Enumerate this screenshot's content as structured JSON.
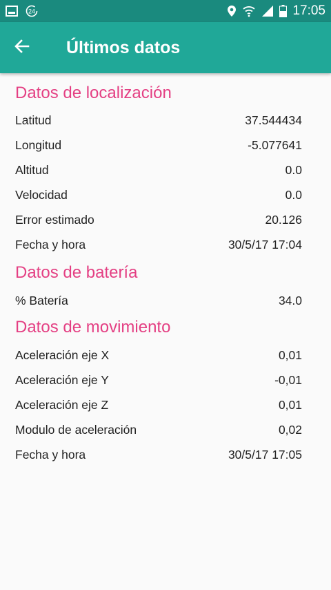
{
  "status_bar": {
    "time": "17:05",
    "left_icons": [
      "gallery-notification-icon",
      "data-saver-24-icon"
    ],
    "right_icons": [
      "location-icon",
      "wifi-icon",
      "signal-icon",
      "battery-icon"
    ]
  },
  "app_bar": {
    "title": "Últimos datos",
    "back_icon": "arrow-left-icon"
  },
  "sections": [
    {
      "title": "Datos de localización",
      "rows": [
        {
          "label": "Latitud",
          "value": "37.544434"
        },
        {
          "label": "Longitud",
          "value": "-5.077641"
        },
        {
          "label": "Altitud",
          "value": "0.0"
        },
        {
          "label": "Velocidad",
          "value": "0.0"
        },
        {
          "label": "Error estimado",
          "value": "20.126"
        },
        {
          "label": "Fecha y hora",
          "value": "30/5/17 17:04"
        }
      ]
    },
    {
      "title": "Datos de batería",
      "rows": [
        {
          "label": "% Batería",
          "value": "34.0"
        }
      ]
    },
    {
      "title": "Datos de movimiento",
      "rows": [
        {
          "label": "Aceleración eje X",
          "value": "0,01"
        },
        {
          "label": "Aceleración eje Y",
          "value": "-0,01"
        },
        {
          "label": "Aceleración eje Z",
          "value": "0,01"
        },
        {
          "label": "Modulo de aceleración",
          "value": "0,02"
        },
        {
          "label": "Fecha y hora",
          "value": "30/5/17 17:05"
        }
      ]
    }
  ],
  "colors": {
    "status_bar": "#1a8a7e",
    "app_bar": "#20a898",
    "section_title": "#e43f83",
    "text": "#222222",
    "background": "#fafafa"
  }
}
